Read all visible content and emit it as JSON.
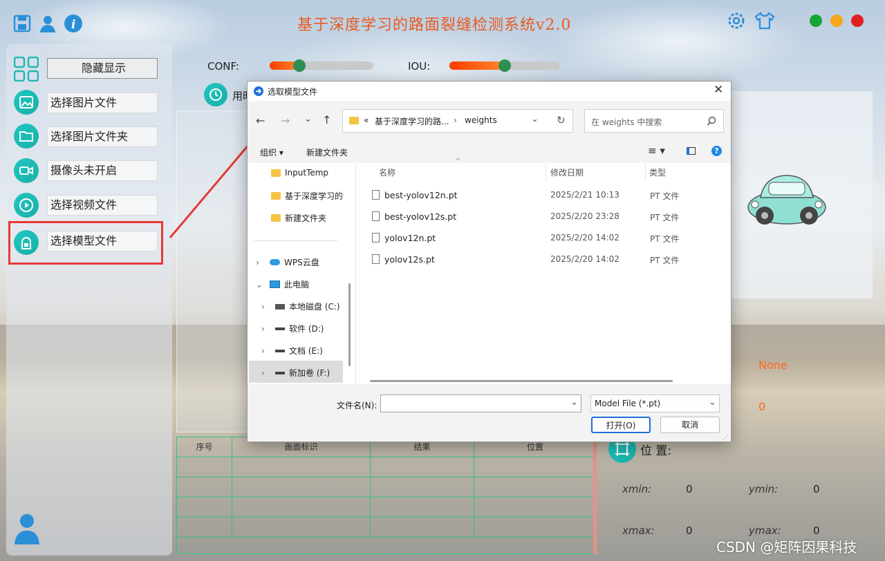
{
  "app": {
    "title": "基于深度学习的路面裂缝检测系统v2.0",
    "watermark": "CSDN @矩阵因果科技"
  },
  "sidebar": {
    "items": [
      {
        "label": "隐藏显示",
        "icon": "grid-icon"
      },
      {
        "label": "选择图片文件",
        "icon": "image-icon"
      },
      {
        "label": "选择图片文件夹",
        "icon": "folder-icon"
      },
      {
        "label": "摄像头未开启",
        "icon": "camera-icon"
      },
      {
        "label": "选择视频文件",
        "icon": "play-icon"
      },
      {
        "label": "选择模型文件",
        "icon": "model-icon"
      }
    ]
  },
  "controls": {
    "conf_label": "CONF:",
    "iou_label": "IOU:",
    "conf_value": 0.35,
    "iou_value": 0.5,
    "time_label_partial": "用时"
  },
  "table": {
    "headers": [
      "序号",
      "画面标识",
      "结果",
      "位置"
    ]
  },
  "right_panel": {
    "result_value": "None",
    "count_value": "0",
    "position_label": "位 置:",
    "xmin_label": "xmin:",
    "xmin_value": "0",
    "ymin_label": "ymin:",
    "ymin_value": "0",
    "xmax_label": "xmax:",
    "xmax_value": "0",
    "ymax_label": "ymax:",
    "ymax_value": "0"
  },
  "dialog": {
    "title": "选取模型文件",
    "address": {
      "prefix": "«",
      "crumb1": "基于深度学习的路...",
      "sep": "›",
      "crumb2": "weights"
    },
    "search_placeholder": "在 weights 中搜索",
    "toolbar": {
      "organize": "组织 ▾",
      "new_folder": "新建文件夹"
    },
    "nav": [
      {
        "label": "InputTemp"
      },
      {
        "label": "基于深度学习的"
      },
      {
        "label": "新建文件夹"
      },
      {
        "label": "WPS云盘"
      },
      {
        "label": "此电脑"
      },
      {
        "label": "本地磁盘 (C:)"
      },
      {
        "label": "软件 (D:)"
      },
      {
        "label": "文档 (E:)"
      },
      {
        "label": "新加卷 (F:)"
      }
    ],
    "columns": {
      "name": "名称",
      "date": "修改日期",
      "type": "类型"
    },
    "files": [
      {
        "name": "best-yolov12n.pt",
        "date": "2025/2/21 10:13",
        "type": "PT 文件"
      },
      {
        "name": "best-yolov12s.pt",
        "date": "2025/2/20 23:28",
        "type": "PT 文件"
      },
      {
        "name": "yolov12n.pt",
        "date": "2025/2/20 14:02",
        "type": "PT 文件"
      },
      {
        "name": "yolov12s.pt",
        "date": "2025/2/20 14:02",
        "type": "PT 文件"
      }
    ],
    "filename_label": "文件名(N):",
    "filename_value": "",
    "filter": "Model File (*.pt)",
    "open_button": "打开(O)",
    "cancel_button": "取消"
  }
}
